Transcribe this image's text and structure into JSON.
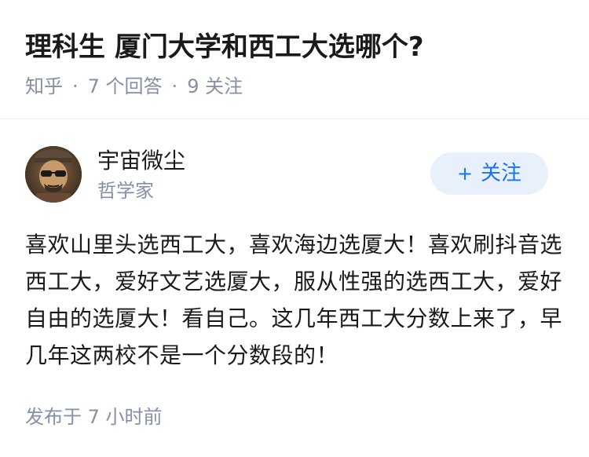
{
  "question": {
    "title": "理科生 厦门大学和西工大选哪个?",
    "meta": {
      "source": "知乎",
      "separator": "·",
      "answers": "7 个回答",
      "followers": "9 关注"
    }
  },
  "answer": {
    "author": {
      "name": "宇宙微尘",
      "title": "哲学家",
      "avatar_icon": "avatar-person-with-sunglasses"
    },
    "follow_button": {
      "plus": "+",
      "label": "关注"
    },
    "content": "喜欢山里头选西工大，喜欢海边选厦大！喜欢刷抖音选西工大，爱好文艺选厦大，服从性强的选西工大，爱好自由的选厦大！看自己。这几年西工大分数上来了，早几年这两校不是一个分数段的！",
    "published": "发布于 7 小时前"
  },
  "colors": {
    "accent": "#1772f6",
    "accent_bg": "#e8f1fb",
    "meta_gray": "#8590a6",
    "text": "#1a1a1a"
  }
}
